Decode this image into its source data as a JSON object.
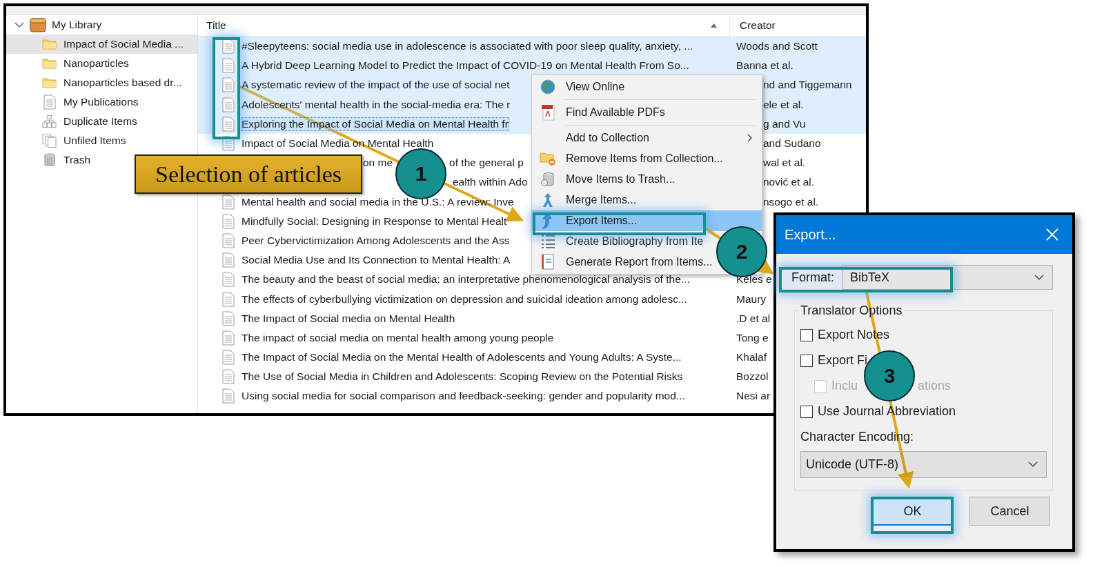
{
  "library": {
    "tree": [
      {
        "label": "My Library",
        "expanded": true,
        "selected": false,
        "children": [
          {
            "label": "Impact of Social Media ...",
            "selected": true
          },
          {
            "label": "Nanoparticles",
            "selected": false
          },
          {
            "label": "Nanoparticles based dr...",
            "selected": false
          },
          {
            "label": "My Publications",
            "selected": false
          },
          {
            "label": "Duplicate Items",
            "selected": false
          },
          {
            "label": "Unfiled Items",
            "selected": false
          },
          {
            "label": "Trash",
            "selected": false
          }
        ]
      }
    ]
  },
  "items": {
    "columns": [
      {
        "label": "Title",
        "sorted": true
      },
      {
        "label": "Creator",
        "sorted": false
      }
    ],
    "rows": [
      {
        "title_parts": [
          "#Sleepyteens: social media use in adolescence is associated with poor sleep quality, anxiety, ..."
        ],
        "creator": "Woods and Scott",
        "creator_cut_left": false,
        "selected": true,
        "focused": false
      },
      {
        "title_parts": [
          "A Hybrid Deep Learning Model to Predict the Impact of COVID-19 on Mental Health From So..."
        ],
        "creator": "Banna et al.",
        "creator_cut_left": false,
        "selected": true,
        "focused": false
      },
      {
        "title_parts": [
          "A systematic review of the impact of the use of social net"
        ],
        "creator": "nd and Tiggemann",
        "creator_cut_left": true,
        "selected": true,
        "focused": false
      },
      {
        "title_parts": [
          "Adolescents' mental health in the social-media era: The r"
        ],
        "creator": "ele et al.",
        "creator_cut_left": true,
        "selected": true,
        "focused": false
      },
      {
        "title_parts": [
          "Exploring the Impact of Social Media on Mental Health fr"
        ],
        "creator": "g and Vu",
        "creator_cut_left": true,
        "selected": true,
        "focused": true
      },
      {
        "title_parts": [
          "Impact of Social Media on Mental Health"
        ],
        "creator": "and Sudano",
        "creator_cut_left": true,
        "selected": false,
        "focused": false
      },
      {
        "title_parts": [
          "on me",
          "of the general p"
        ],
        "creator": "wal et al.",
        "creator_cut_left": true,
        "selected": false,
        "focused": false
      },
      {
        "title_parts": [
          "ealth within Ado"
        ],
        "creator": "nović et al.",
        "creator_cut_left": true,
        "selected": false,
        "focused": false
      },
      {
        "title_parts": [
          "Mental health and social media in the U.S.: A review: Inve"
        ],
        "creator": "nsogo et al.",
        "creator_cut_left": true,
        "selected": false,
        "focused": false
      },
      {
        "title_parts": [
          "Mindfully Social: Designing in Response to Mental Healt"
        ],
        "selected": false,
        "focused": false
      },
      {
        "title_parts": [
          "Peer Cybervictimization Among Adolescents and the Ass"
        ],
        "selected": false,
        "focused": false
      },
      {
        "title_parts": [
          "Social Media Use and Its Connection to Mental Health: A"
        ],
        "selected": false,
        "focused": false
      },
      {
        "title_parts": [
          "The beauty and the beast of social media: an interpretative phenomenological analysis of the..."
        ],
        "creator": "Keles e",
        "creator_cut_left": false,
        "selected": false,
        "focused": false
      },
      {
        "title_parts": [
          "The effects of cyberbullying victimization on depression and suicidal ideation among adolesc..."
        ],
        "creator": "Maury",
        "creator_cut_left": false,
        "selected": false,
        "focused": false
      },
      {
        "title_parts": [
          "The Impact of Social media on Mental Health"
        ],
        "creator": ".D et al",
        "creator_cut_left": false,
        "selected": false,
        "focused": false
      },
      {
        "title_parts": [
          "The impact of social media on mental health among young people"
        ],
        "creator": "Tong e",
        "creator_cut_left": false,
        "selected": false,
        "focused": false
      },
      {
        "title_parts": [
          "The Impact of Social Media on the Mental Health of Adolescents and Young Adults: A Syste..."
        ],
        "creator": "Khalaf",
        "creator_cut_left": false,
        "selected": false,
        "focused": false
      },
      {
        "title_parts": [
          "The Use of Social Media in Children and Adolescents: Scoping Review on the Potential Risks"
        ],
        "creator": "Bozzol",
        "creator_cut_left": false,
        "selected": false,
        "focused": false
      },
      {
        "title_parts": [
          "Using social media for social comparison and feedback-seeking: gender and popularity mod..."
        ],
        "creator": "Nesi ar",
        "creator_cut_left": false,
        "selected": false,
        "focused": false
      }
    ]
  },
  "context_menu": {
    "groups": [
      [
        {
          "label": "View Online",
          "submenu": false,
          "selected": false
        }
      ],
      [
        {
          "label": "Find Available PDFs",
          "submenu": false,
          "selected": false
        }
      ],
      [
        {
          "label": "Add to Collection",
          "submenu": true,
          "selected": false
        },
        {
          "label": "Remove Items from Collection...",
          "submenu": false,
          "selected": false
        },
        {
          "label": "Move Items to Trash...",
          "submenu": false,
          "selected": false
        },
        {
          "label": "Merge Items...",
          "submenu": false,
          "selected": false
        }
      ],
      [
        {
          "label": "Export Items...",
          "submenu": false,
          "selected": true
        },
        {
          "label": "Create Bibliography from Ite",
          "submenu": false,
          "selected": false
        },
        {
          "label": "Generate Report from Items...",
          "submenu": false,
          "selected": false
        }
      ]
    ]
  },
  "export_dialog": {
    "title": "Export...",
    "format": {
      "label": "Format:",
      "value": "BibTeX"
    },
    "options": {
      "legend": "Translator Options",
      "checkboxes": [
        {
          "label_parts": [
            "Export Notes"
          ],
          "checked": false,
          "disabled": false
        },
        {
          "label_parts": [
            "Export Fi"
          ],
          "checked": false,
          "disabled": false,
          "children": [
            {
              "label_parts": [
                "Inclu",
                "ations"
              ],
              "checked": false,
              "disabled": true
            }
          ]
        },
        {
          "label_parts": [
            "Use Journal Abbreviation"
          ],
          "checked": false,
          "disabled": false
        }
      ]
    },
    "encoding": {
      "label": "Character Encoding:",
      "value": "Unicode (UTF-8)"
    },
    "buttons": [
      {
        "label": "OK",
        "default": true
      },
      {
        "label": "Cancel",
        "default": false
      }
    ]
  },
  "annotations": {
    "callout": "Selection of articles",
    "steps": [
      "1",
      "2",
      "3"
    ]
  }
}
